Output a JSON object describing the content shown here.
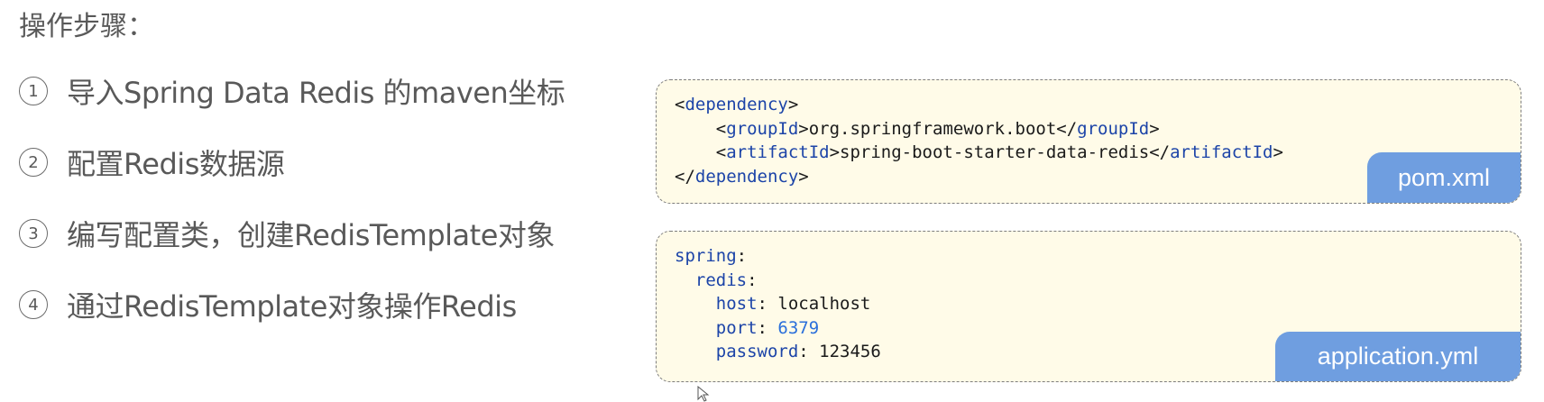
{
  "heading": "操作步骤：",
  "steps": [
    {
      "num": "1",
      "text": "导入Spring Data Redis 的maven坐标"
    },
    {
      "num": "2",
      "text": "配置Redis数据源"
    },
    {
      "num": "3",
      "text": "编写配置类，创建RedisTemplate对象"
    },
    {
      "num": "4",
      "text": "通过RedisTemplate对象操作Redis"
    }
  ],
  "pom": {
    "file_label": "pom.xml",
    "dependency_tag": "dependency",
    "groupId_tag": "groupId",
    "groupId_value": "org.springframework.boot",
    "artifactId_tag": "artifactId",
    "artifactId_value": "spring-boot-starter-data-redis"
  },
  "yml": {
    "file_label": "application.yml",
    "spring_key": "spring",
    "redis_key": "redis",
    "host_key": "host",
    "host_value": "localhost",
    "port_key": "port",
    "port_value": "6379",
    "password_key": "password",
    "password_value": "123456"
  },
  "colors": {
    "text_gray": "#595959",
    "code_bg": "#fffbe8",
    "xml_tag": "#1c44a8",
    "yaml_number": "#2a6fdb",
    "file_tab": "#6f9ee0"
  }
}
